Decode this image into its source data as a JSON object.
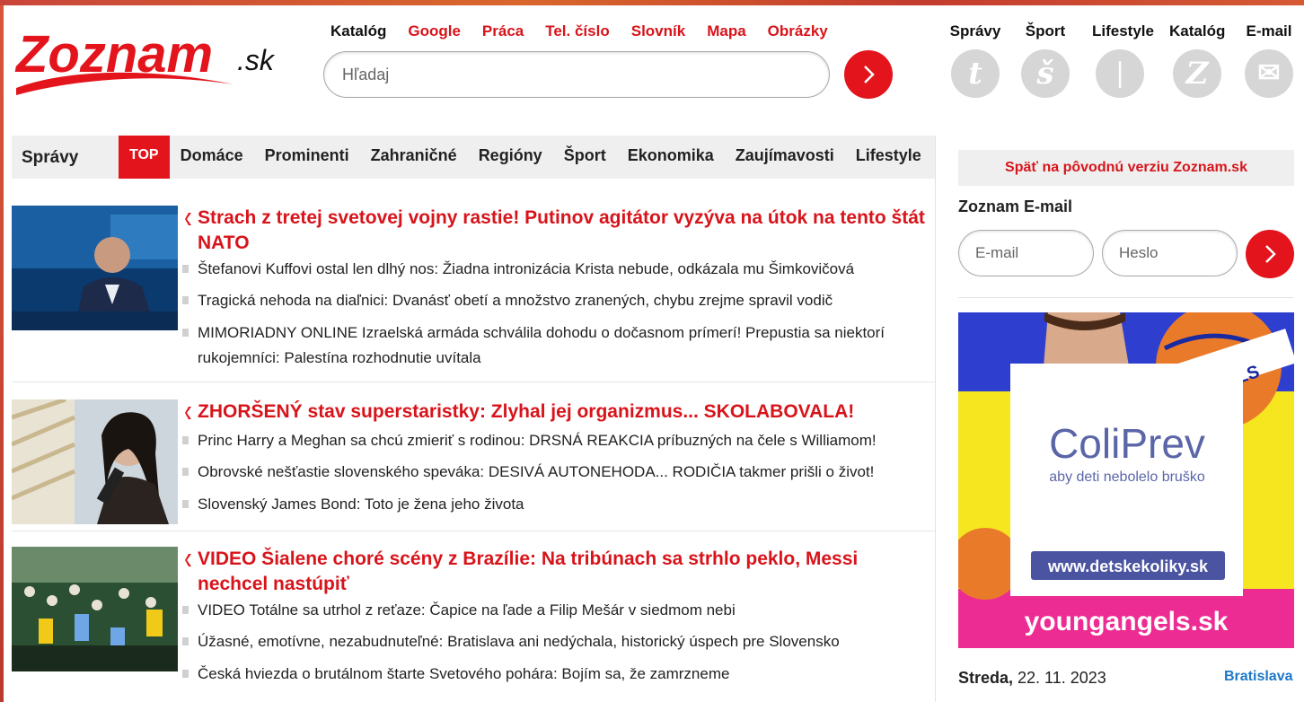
{
  "logo": {
    "main": "Zoznam",
    "suffix": ".sk"
  },
  "header_links": [
    {
      "label": "Katalóg",
      "dark": true
    },
    {
      "label": "Google",
      "dark": false
    },
    {
      "label": "Práca",
      "dark": false
    },
    {
      "label": "Tel. číslo",
      "dark": false
    },
    {
      "label": "Slovník",
      "dark": false
    },
    {
      "label": "Mapa",
      "dark": false
    },
    {
      "label": "Obrázky",
      "dark": false
    }
  ],
  "search": {
    "placeholder": "Hľadaj"
  },
  "services": [
    {
      "label": "Správy",
      "icon": "spravy-icon",
      "glyph": "t"
    },
    {
      "label": "Šport",
      "icon": "sport-icon",
      "glyph": "š"
    },
    {
      "label": "Lifestyle",
      "icon": "lifestyle-icon",
      "glyph": "|"
    },
    {
      "label": "Katalóg",
      "icon": "katalog-icon",
      "glyph": "Z"
    },
    {
      "label": "E-mail",
      "icon": "envelope-icon",
      "glyph": "✉"
    }
  ],
  "nav": {
    "section": "Správy",
    "tabs": [
      "TOP",
      "Domáce",
      "Prominenti",
      "Zahraničné",
      "Regióny",
      "Šport",
      "Ekonomika",
      "Zaujímavosti",
      "Lifestyle"
    ],
    "active": "TOP"
  },
  "articles": [
    {
      "headline": "Strach z tretej svetovej vojny rastie! Putinov agitátor vyzýva na útok na tento štát NATO",
      "subs": [
        "Štefanovi Kuffovi ostal len dlhý nos: Žiadna intronizácia Krista nebude, odkázala mu Šimkovičová",
        "Tragická nehoda na diaľnici: Dvanásť obetí a množstvo zranených, chybu zrejme spravil vodič",
        "MIMORIADNY ONLINE Izraelská armáda schválila dohodu o dočasnom prímerí! Prepustia sa niektorí rukojemníci: Palestína rozhodnutie uvítala"
      ]
    },
    {
      "headline": "ZHORŠENÝ stav superstaristky: Zlyhal jej organizmus... SKOLABOVALA!",
      "subs": [
        "Princ Harry a Meghan sa chcú zmieriť s rodinou: DRSNÁ REAKCIA príbuzných na čele s Williamom!",
        "Obrovské nešťastie slovenského speváka: DESIVÁ AUTONEHODA... RODIČIA takmer prišli o život!",
        "Slovenský James Bond: Toto je žena jeho života"
      ]
    },
    {
      "headline": "VIDEO Šialene choré scény z Brazílie: Na tribúnach sa strhlo peklo, Messi nechcel nastúpiť",
      "subs": [
        "VIDEO Totálne sa utrhol z reťaze: Čapice na ľade a Filip Mešár v siedmom nebi",
        "Úžasné, emotívne, nezabudnuteľné: Bratislava ani nedýchala, historický úspech pre Slovensko",
        "Česká hviezda o brutálnom štarte Svetového pohára: Bojím sa, že zamrzneme"
      ]
    }
  ],
  "sidebar": {
    "back_link": "Späť na pôvodnú verziu Zoznam.sk",
    "email_title": "Zoznam E-mail",
    "email_placeholder": "E-mail",
    "password_placeholder": "Heslo",
    "ad": {
      "brand": "ColiPrev",
      "tagline": "aby deti nebolelo bruško",
      "url": "www.detskekoliky.sk",
      "footer": "youngangels.sk",
      "badge": "ANGELS"
    },
    "date_day": "Streda,",
    "date_value": " 22. 11. 2023",
    "city": "Bratislava"
  },
  "colors": {
    "brand_red": "#e3141b",
    "link_red": "#d8141b",
    "nav_bg": "#efefef",
    "icon_grey": "#d6d6d6",
    "city_blue": "#1d78c8"
  }
}
